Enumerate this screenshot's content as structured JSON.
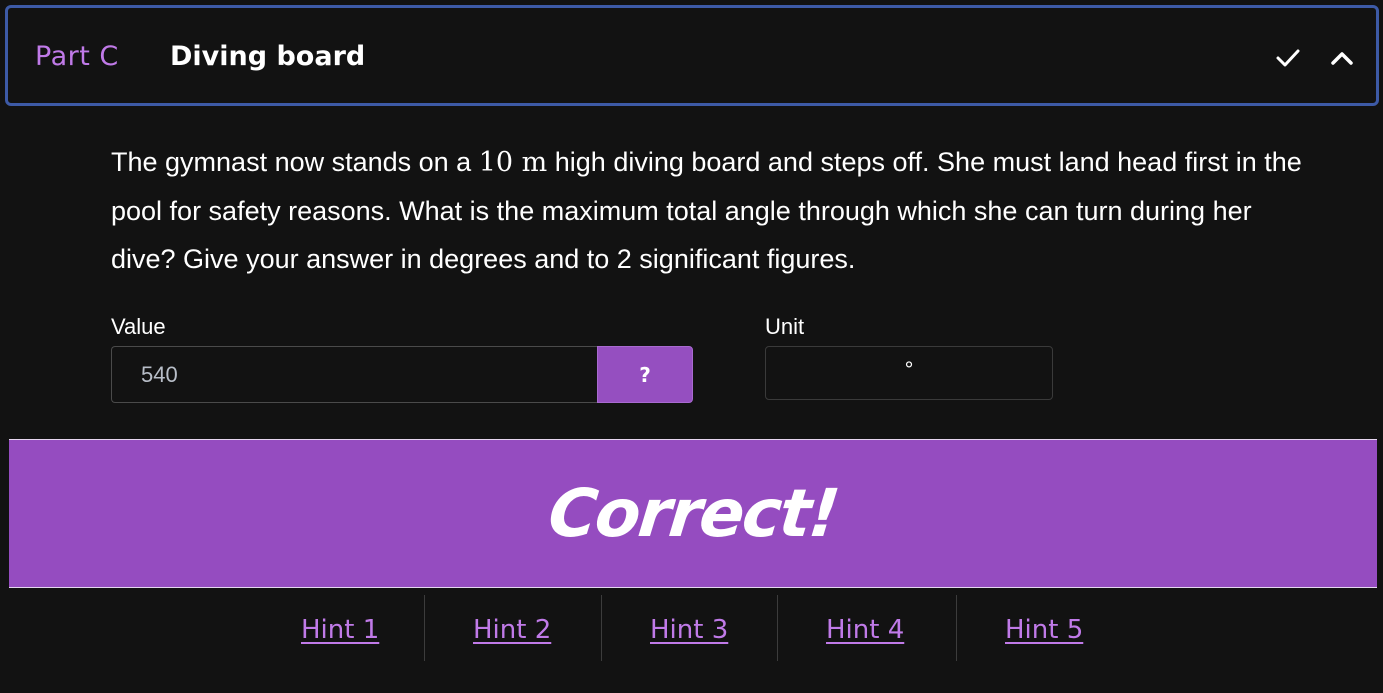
{
  "header": {
    "part_label": "Part C",
    "title": "Diving board",
    "check_icon": "check-icon",
    "collapse_icon": "chevron-up-icon",
    "border_color": "#3d5aa6",
    "accent_color": "#c07ae8"
  },
  "question": {
    "text_before": "The gymnast now stands on a ",
    "math": "10 m",
    "text_after": " high diving board and steps off. She must land head first in the pool for safety reasons. What is the maximum total angle through which she can turn during her dive? Give your answer in degrees and to 2 significant figures."
  },
  "answer": {
    "value_label": "Value",
    "value": "540",
    "help_label": "?",
    "unit_label": "Unit",
    "unit_value": "°"
  },
  "feedback": {
    "text": "Correct!",
    "color": "#954cc0"
  },
  "hints": [
    "Hint 1",
    "Hint 2",
    "Hint 3",
    "Hint 4",
    "Hint 5"
  ]
}
